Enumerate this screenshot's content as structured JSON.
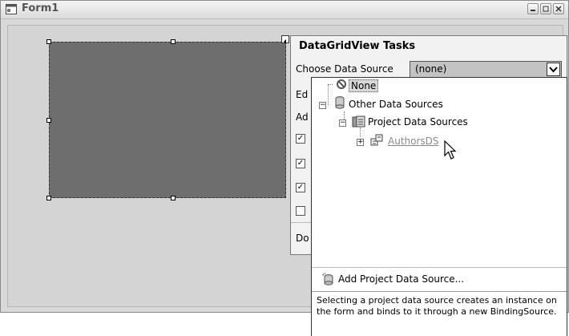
{
  "window": {
    "title": "Form1"
  },
  "tasks": {
    "title": "DataGridView Tasks",
    "choose_label": "Choose Data Source",
    "combo_value": "(none)",
    "partial_rows": [
      "Ed",
      "Ad",
      "Do"
    ]
  },
  "dropdown": {
    "tree": {
      "none": "None",
      "other": "Other Data Sources",
      "project": "Project Data Sources",
      "authors": "AuthorsDS"
    },
    "add_label": "Add Project Data Source...",
    "help": "Selecting a project data source creates an instance on the form and binds to it through a new BindingSource."
  },
  "icons": [
    "form-icon",
    "none-icon",
    "database-icon",
    "project-icon",
    "dataset-icon",
    "cursor-icon"
  ]
}
